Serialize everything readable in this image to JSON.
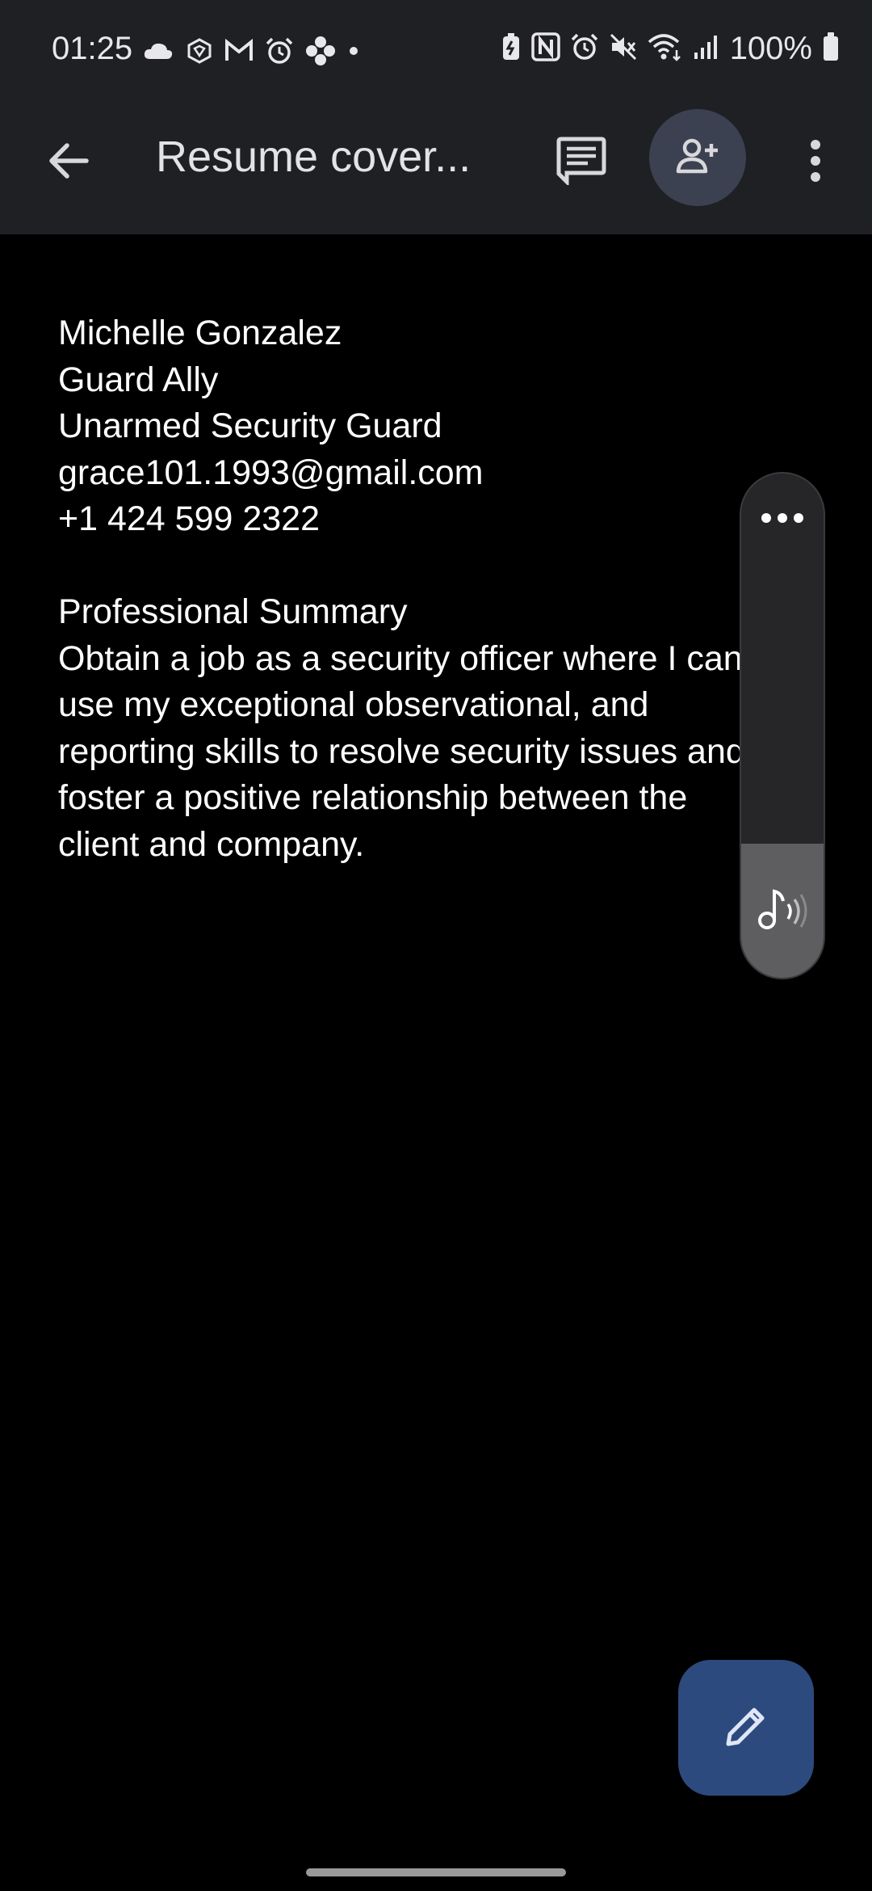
{
  "status_bar": {
    "time": "01:25",
    "battery_text": "100%",
    "left_icons": [
      "cloud-icon",
      "app-icon",
      "gmail-icon",
      "alarm-icon",
      "flower-icon",
      "dot-icon"
    ],
    "right_icons": [
      "battery-saver-icon",
      "nfc-icon",
      "alarm-icon",
      "mute-icon",
      "wifi-icon",
      "signal-icon",
      "battery-icon"
    ]
  },
  "app_bar": {
    "title": "Resume cover...",
    "back_icon": "arrow-back-icon",
    "comment_icon": "comment-icon",
    "share_icon": "add-person-icon",
    "more_icon": "more-vert-icon"
  },
  "document": {
    "contact_lines": [
      "Michelle Gonzalez",
      "Guard Ally",
      "Unarmed Security Guard",
      "grace101.1993@gmail.com",
      "+1 424 599 2322"
    ],
    "summary_heading": "Professional Summary",
    "summary_text": "Obtain a job as a security officer where I can use my exceptional observational, and reporting skills to resolve security issues and foster a positive relationship between the client and company."
  },
  "float_panel": {
    "menu_icon": "more-horiz-icon",
    "read_aloud_icon": "read-aloud-icon"
  },
  "fab": {
    "icon": "edit-pencil-icon",
    "color": "#2c4a7e"
  },
  "colors": {
    "bar_bg": "#1f2024",
    "page_bg": "#000000",
    "share_btn_bg": "#3b4150"
  }
}
